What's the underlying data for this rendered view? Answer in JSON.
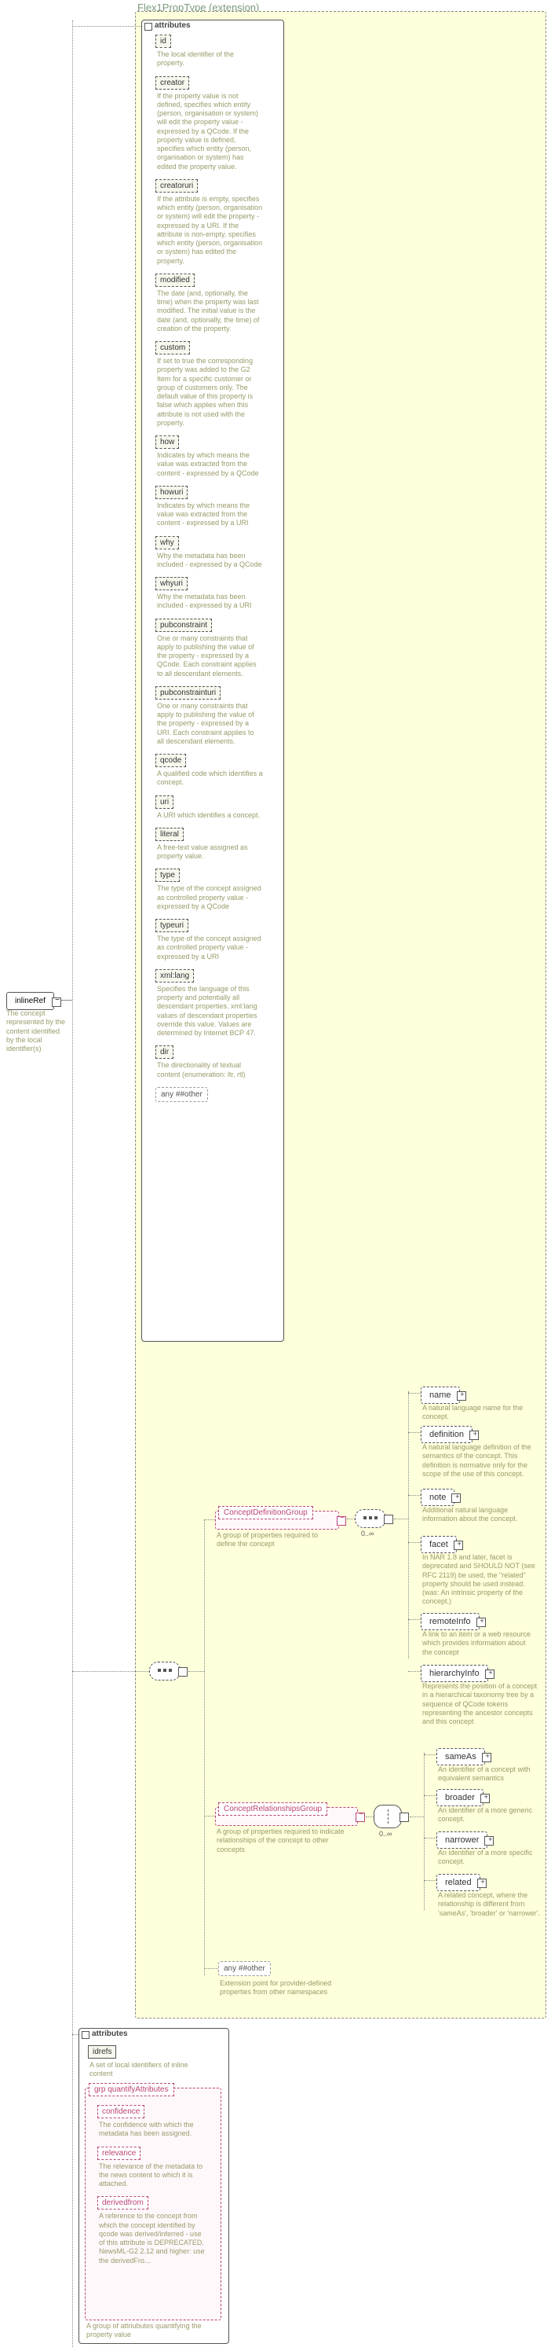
{
  "header": {
    "type_label": "Flex1PropType (extension)"
  },
  "root": {
    "name": "inlineRef",
    "desc": "The concept represented by the content identified by the local identifier(s)"
  },
  "attr1": {
    "section": "attributes",
    "items": [
      {
        "name": "id",
        "desc": "The local identifier of the property."
      },
      {
        "name": "creator",
        "desc": "If the property value is not defined, specifies which entity (person, organisation or system) will edit the property value - expressed by a QCode. If the property value is defined, specifies which entity (person, organisation or system) has edited the property value."
      },
      {
        "name": "creatoruri",
        "desc": "If the attribute is empty, specifies which entity (person, organisation or system) will edit the property - expressed by a URI. If the attribute is non-empty, specifies which entity (person, organisation or system) has edited the property."
      },
      {
        "name": "modified",
        "desc": "The date (and, optionally, the time) when the property was last modified. The initial value is the date (and, optionally, the time) of creation of the property."
      },
      {
        "name": "custom",
        "desc": "If set to true the corresponding property was added to the G2 Item for a specific customer or group of customers only. The default value of this property is false which applies when this attribute is not used with the property."
      },
      {
        "name": "how",
        "desc": "Indicates by which means the value was extracted from the content - expressed by a QCode"
      },
      {
        "name": "howuri",
        "desc": "Indicates by which means the value was extracted from the content - expressed by a URI"
      },
      {
        "name": "why",
        "desc": "Why the metadata has been included - expressed by a QCode"
      },
      {
        "name": "whyuri",
        "desc": "Why the metadata has been included - expressed by a URI"
      },
      {
        "name": "pubconstraint",
        "desc": "One or many constraints that apply to publishing the value of the property - expressed by a QCode. Each constraint applies to all descendant elements."
      },
      {
        "name": "pubconstrainturi",
        "desc": "One or many constraints that apply to publishing the value of the property - expressed by a URI. Each constraint applies to all descendant elements."
      },
      {
        "name": "qcode",
        "desc": "A qualified code which identifies a concept."
      },
      {
        "name": "uri",
        "desc": "A URI which identifies a concept."
      },
      {
        "name": "literal",
        "desc": "A free-text value assigned as property value."
      },
      {
        "name": "type",
        "desc": "The type of the concept assigned as controlled property value - expressed by a QCode"
      },
      {
        "name": "typeuri",
        "desc": "The type of the concept assigned as controlled property value - expressed by a URI"
      },
      {
        "name": "xml:lang",
        "desc": "Specifies the language of this property and potentially all descendant properties. xml:lang values of descendant properties override this value. Values are determined by Internet BCP 47."
      },
      {
        "name": "dir",
        "desc": "The directionality of textual content (enumeration: ltr, rtl)"
      }
    ],
    "any": "any ##other"
  },
  "groups": {
    "cdg": {
      "label": "ConceptDefinitionGroup",
      "desc": "A group of properties required to define the concept"
    },
    "crg": {
      "label": "ConceptRelationshipsGroup",
      "desc": "A group of properties required to indicate relationships of the concept to other concepts"
    }
  },
  "cdg_elems": [
    {
      "name": "name",
      "desc": "A natural language name for the concept."
    },
    {
      "name": "definition",
      "desc": "A natural language definition of the semantics of the concept. This definition is normative only for the scope of the use of this concept."
    },
    {
      "name": "note",
      "desc": "Additional natural language information about the concept."
    },
    {
      "name": "facet",
      "desc": "In NAR 1.8 and later, facet is deprecated and SHOULD NOT (see RFC 2119) be used, the \"related\" property should be used instead.(was: An intrinsic property of the concept.)"
    },
    {
      "name": "remoteInfo",
      "desc": "A link to an item or a web resource which provides information about the concept"
    },
    {
      "name": "hierarchyInfo",
      "desc": "Represents the position of a concept in a hierarchical taxonomy tree by a sequence of QCode tokens representing the ancestor concepts and this concept"
    }
  ],
  "crg_elems": [
    {
      "name": "sameAs",
      "desc": "An identifier of a concept with equivalent semantics"
    },
    {
      "name": "broader",
      "desc": "An identifier of a more generic concept."
    },
    {
      "name": "narrower",
      "desc": "An identifier of a more specific concept."
    },
    {
      "name": "related",
      "desc": "A related concept, where the relationship is different from 'sameAs', 'broader' or 'narrower'."
    }
  ],
  "seq_any": {
    "label": "any ##other",
    "desc": "Extension point for provider-defined properties from other namespaces"
  },
  "attr2": {
    "section": "attributes",
    "idrefs": {
      "name": "idrefs",
      "desc": "A set of local identifiers of inline content"
    },
    "group": {
      "label": "grp quantifyAttributes",
      "desc": "A group of attriubutes quantifying the property value",
      "items": [
        {
          "name": "confidence",
          "desc": "The confidence with which the metadata has been assigned."
        },
        {
          "name": "relevance",
          "desc": "The relevance of the metadata to the news content to which it is attached."
        },
        {
          "name": "derivedfrom",
          "desc": "A reference to the concept from which the concept identified by qcode was derived/inferred - use of this attribute is DEPRECATED. NewsML-G2 2.12 and higher: use the derivedFro..."
        }
      ]
    }
  },
  "labels": {
    "attrs": "attributes"
  },
  "card": {
    "zero_inf": "0..∞"
  }
}
